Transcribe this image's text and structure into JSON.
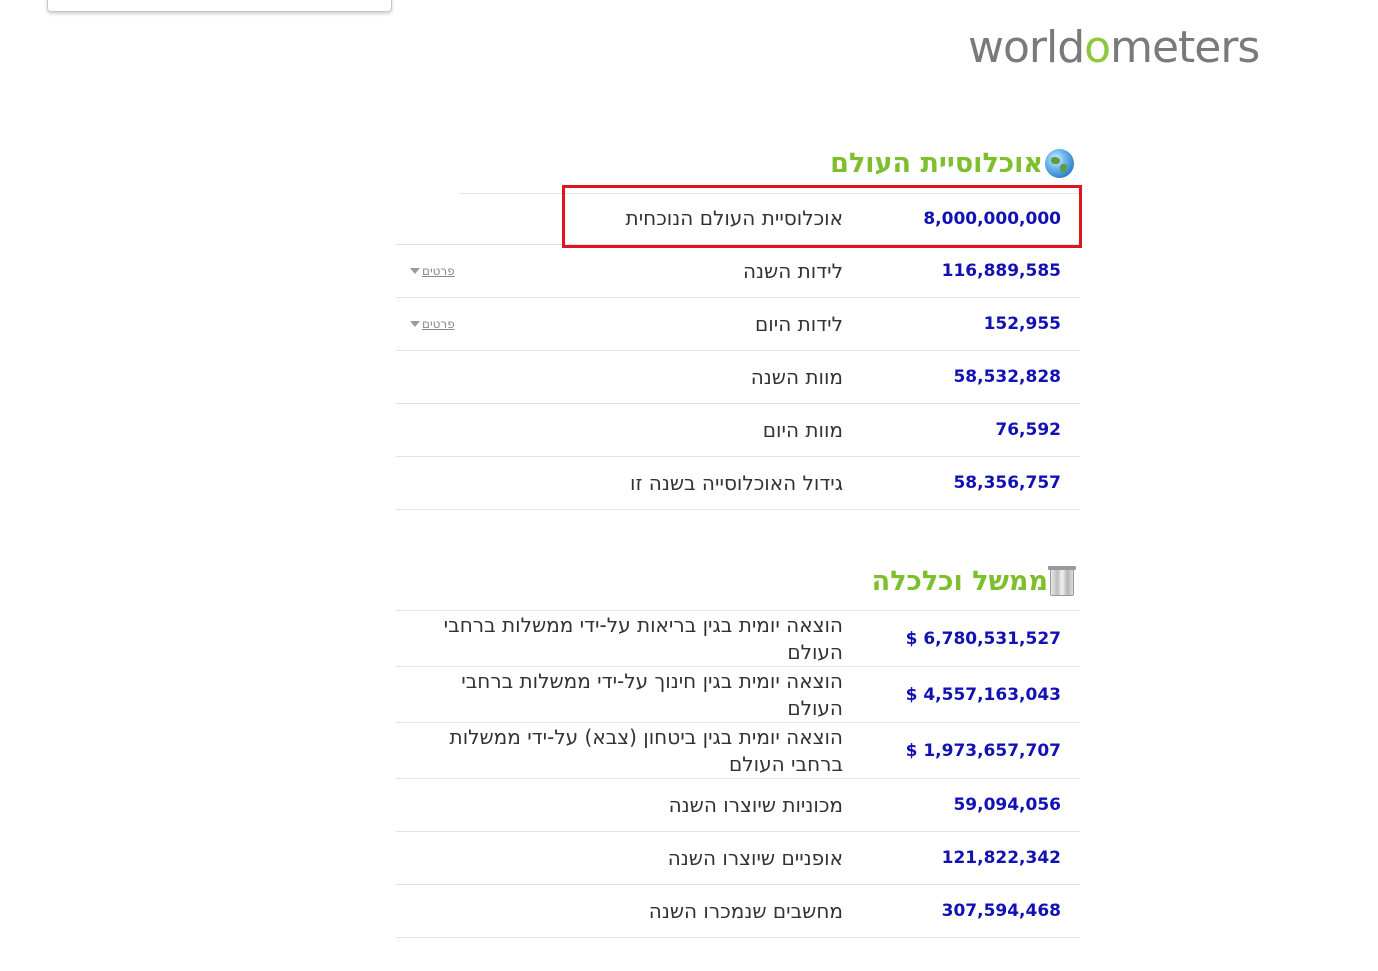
{
  "logo": {
    "part1": "world",
    "part2": "o",
    "part3": "meters"
  },
  "sections": [
    {
      "title": "אוכלוסיית העולם",
      "icon": "globe-icon",
      "rows": [
        {
          "value": "8,000,000,000",
          "label": "אוכלוסיית העולם הנוכחית"
        },
        {
          "value": "116,889,585",
          "label": "לידות השנה",
          "details": "פרטים"
        },
        {
          "value": "152,955",
          "label": "לידות היום",
          "details": "פרטים"
        },
        {
          "value": "58,532,828",
          "label": "מוות השנה"
        },
        {
          "value": "76,592",
          "label": "מוות היום"
        },
        {
          "value": "58,356,757",
          "label": "גידול האוכלוסייה בשנה זו"
        }
      ]
    },
    {
      "title": "ממשל וכלכלה",
      "icon": "pillar-icon",
      "rows": [
        {
          "value": "$ 6,780,531,527",
          "label": "הוצאה יומית בגין בריאות על-ידי ממשלות ברחבי העולם"
        },
        {
          "value": "$ 4,557,163,043",
          "label": "הוצאה יומית בגין חינוך על-ידי ממשלות ברחבי העולם"
        },
        {
          "value": "$ 1,973,657,707",
          "label": "הוצאה יומית בגין ביטחון (צבא) על-ידי ממשלות ברחבי העולם"
        },
        {
          "value": "59,094,056",
          "label": "מכוניות שיוצרו השנה"
        },
        {
          "value": "121,822,342",
          "label": "אופניים שיוצרו השנה"
        },
        {
          "value": "307,594,468",
          "label": "מחשבים שנמכרו השנה"
        }
      ]
    }
  ],
  "colors": {
    "accent": "#7dbf2c",
    "value": "#1212b4",
    "highlight": "#e0141e"
  }
}
